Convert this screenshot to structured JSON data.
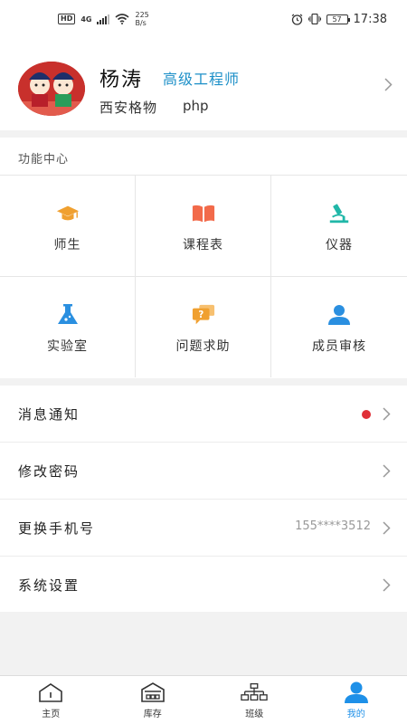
{
  "status_bar": {
    "hd": "HD",
    "network": "4G",
    "speed_value": "225",
    "speed_unit": "B/s",
    "battery": "57",
    "time": "17:38"
  },
  "profile": {
    "name": "杨涛",
    "title": "高级工程师",
    "org": "西安格物",
    "dept": "php"
  },
  "function_center": {
    "header": "功能中心",
    "items": [
      {
        "label": "师生",
        "icon": "graduation-cap-icon",
        "color": "#f0a030"
      },
      {
        "label": "课程表",
        "icon": "open-book-icon",
        "color": "#f26a4a"
      },
      {
        "label": "仪器",
        "icon": "microscope-icon",
        "color": "#20b7a8"
      },
      {
        "label": "实验室",
        "icon": "flask-icon",
        "color": "#2a8fe0"
      },
      {
        "label": "问题求助",
        "icon": "help-chat-icon",
        "color": "#f0a030"
      },
      {
        "label": "成员审核",
        "icon": "user-icon",
        "color": "#2a8fe0"
      }
    ]
  },
  "menu": {
    "messages": {
      "label": "消息通知",
      "has_unread": true
    },
    "password": {
      "label": "修改密码"
    },
    "phone": {
      "label": "更换手机号",
      "value": "155****3512"
    },
    "settings": {
      "label": "系统设置"
    }
  },
  "tabbar": {
    "tabs": [
      {
        "label": "主页",
        "icon": "home-icon",
        "active": false
      },
      {
        "label": "库存",
        "icon": "warehouse-icon",
        "active": false
      },
      {
        "label": "班级",
        "icon": "org-chart-icon",
        "active": false
      },
      {
        "label": "我的",
        "icon": "profile-icon",
        "active": true
      }
    ]
  },
  "colors": {
    "accent": "#1e90e8",
    "title_blue": "#1e90c8",
    "unread_dot": "#e03038"
  }
}
